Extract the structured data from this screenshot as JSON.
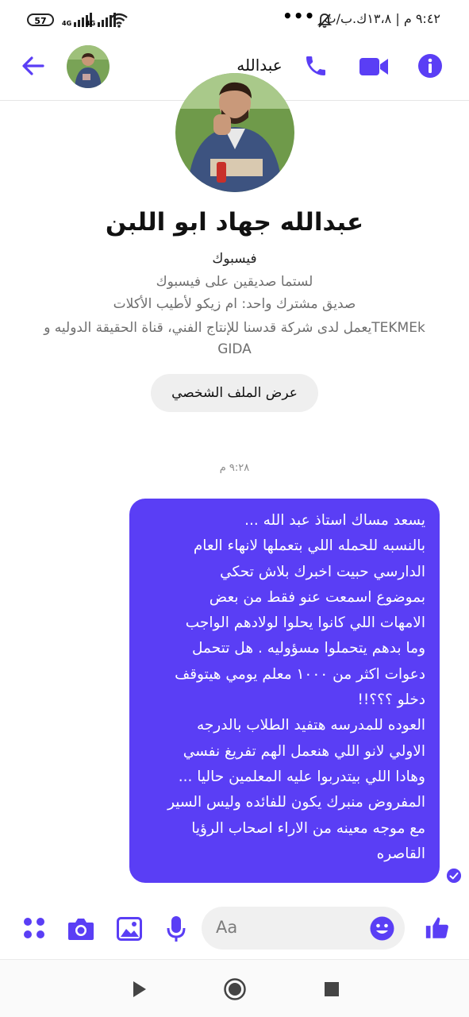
{
  "status_bar": {
    "battery": "57",
    "signal_label_1": "4G",
    "signal_label_2": "4G",
    "dots": "•••",
    "text": "٩:٤٢ م | ١٣،٨ك.ب/ث"
  },
  "header": {
    "contact_name": "عبدالله"
  },
  "profile": {
    "full_name": "عبدالله جهاد ابو اللبن",
    "platform": "فيسبوك",
    "friend_status": "لستما صديقين على فيسبوك",
    "mutual_friend": "صديق مشترك واحد: ام زيكو لأطيب الأكلات",
    "work_line_1": "TEKMEkيعمل لدى شركة قدسنا للإنتاج الفني، قناة الحقيقة الدوليه و",
    "work_line_2": "GIDA",
    "view_profile_label": "عرض الملف الشخصي"
  },
  "conversation": {
    "timestamp": "٩:٢٨ م",
    "message": "يسعد مساك استاذ عبد الله ...\nبالنسبه للحمله اللي بتعملها لانهاء العام\nالدارسي حبيت اخبرك بلاش تحكي\nبموضوع اسمعت عنو فقط من بعض\nالامهات اللي كانوا يحلوا لولادهم الواجب\nوما بدهم يتحملوا مسؤوليه . هل تتحمل\nدعوات اكثر من ١٠٠٠ معلم يومي هيتوقف\nدخلو ؟؟؟!!\nالعوده للمدرسه هتفيد الطلاب بالدرجه\nالاولي لانو اللي هنعمل الهم تفريغ نفسي\nوهادا اللي بيتدربوا عليه المعلمين حاليا ...\nالمفروض منبرك يكون للفائده وليس السير\nمع موجه معينه من الاراء اصحاب الرؤيا\nالقاصره"
  },
  "composer": {
    "placeholder": "Aa"
  },
  "colors": {
    "accent": "#5a3ef5",
    "bubble_text": "#ffffff",
    "muted_text": "#6f6f6f"
  }
}
